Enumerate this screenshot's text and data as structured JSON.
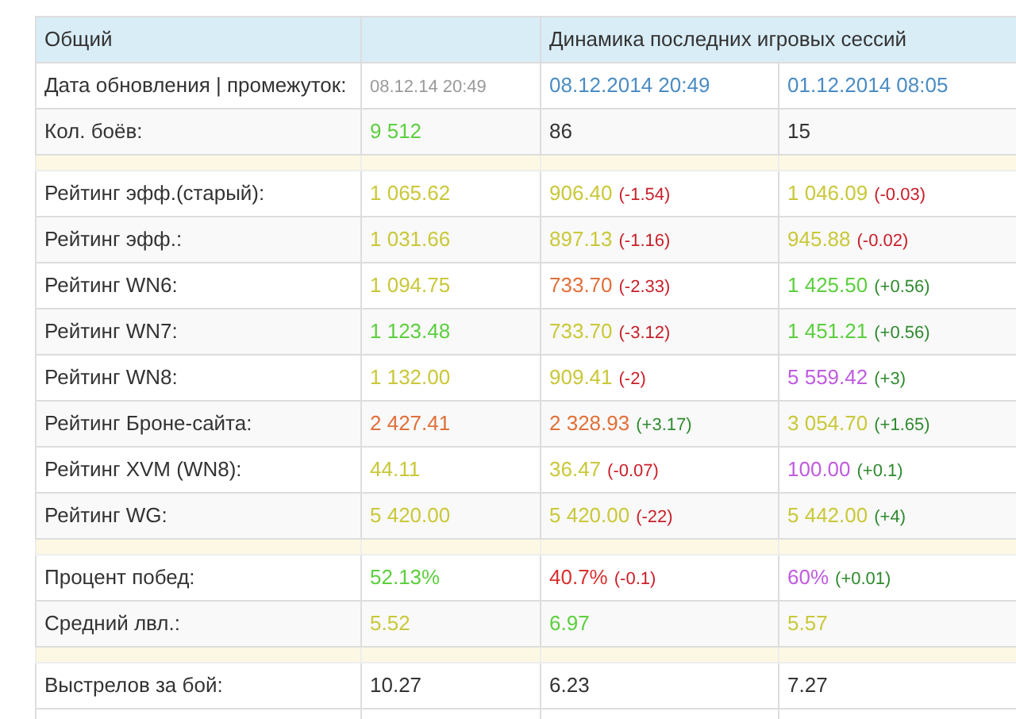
{
  "header": {
    "section": "Общий",
    "dynamics": "Динамика последних игровых сессий"
  },
  "rows": [
    {
      "kind": "data",
      "label": "Дата обновления | промежуток:",
      "cells": [
        {
          "value": "08.12.14 20:49",
          "color": "#9a9a9a",
          "small": true
        },
        {
          "value": "08.12.2014 20:49",
          "color": "#4a8cc4"
        },
        {
          "value": "01.12.2014 08:05",
          "color": "#4a8cc4"
        }
      ]
    },
    {
      "kind": "data",
      "label": "Кол. боёв:",
      "cells": [
        {
          "value": "9 512",
          "color": "#5ccf3e"
        },
        {
          "value": "86",
          "color": "#333333"
        },
        {
          "value": "15",
          "color": "#333333"
        }
      ]
    },
    {
      "kind": "separator"
    },
    {
      "kind": "data",
      "label": "Рейтинг эфф.(старый):",
      "cells": [
        {
          "value": "1 065.62",
          "color": "#c9c83a"
        },
        {
          "value": "906.40",
          "color": "#c9c83a",
          "delta": {
            "text": "(-1.54)",
            "color": "#c8202a"
          }
        },
        {
          "value": "1 046.09",
          "color": "#c9c83a",
          "delta": {
            "text": "(-0.03)",
            "color": "#c8202a"
          }
        }
      ]
    },
    {
      "kind": "data",
      "label": "Рейтинг эфф.:",
      "cells": [
        {
          "value": "1 031.66",
          "color": "#c9c83a"
        },
        {
          "value": "897.13",
          "color": "#c9c83a",
          "delta": {
            "text": "(-1.16)",
            "color": "#c8202a"
          }
        },
        {
          "value": "945.88",
          "color": "#c9c83a",
          "delta": {
            "text": "(-0.02)",
            "color": "#c8202a"
          }
        }
      ]
    },
    {
      "kind": "data",
      "label": "Рейтинг WN6:",
      "cells": [
        {
          "value": "1 094.75",
          "color": "#c9c83a"
        },
        {
          "value": "733.70",
          "color": "#e0703a",
          "delta": {
            "text": "(-2.33)",
            "color": "#c8202a"
          }
        },
        {
          "value": "1 425.50",
          "color": "#5ccf3e",
          "delta": {
            "text": "(+0.56)",
            "color": "#2f8a2f"
          }
        }
      ]
    },
    {
      "kind": "data",
      "label": "Рейтинг WN7:",
      "cells": [
        {
          "value": "1 123.48",
          "color": "#5ccf3e"
        },
        {
          "value": "733.70",
          "color": "#c9c83a",
          "delta": {
            "text": "(-3.12)",
            "color": "#c8202a"
          }
        },
        {
          "value": "1 451.21",
          "color": "#5ccf3e",
          "delta": {
            "text": "(+0.56)",
            "color": "#2f8a2f"
          }
        }
      ]
    },
    {
      "kind": "data",
      "label": "Рейтинг WN8:",
      "cells": [
        {
          "value": "1 132.00",
          "color": "#c9c83a"
        },
        {
          "value": "909.41",
          "color": "#c9c83a",
          "delta": {
            "text": "(-2)",
            "color": "#c8202a"
          }
        },
        {
          "value": "5 559.42",
          "color": "#c05ce0",
          "delta": {
            "text": "(+3)",
            "color": "#2f8a2f"
          }
        }
      ]
    },
    {
      "kind": "data",
      "label": "Рейтинг Броне-сайта:",
      "cells": [
        {
          "value": "2 427.41",
          "color": "#e0703a"
        },
        {
          "value": "2 328.93",
          "color": "#e0703a",
          "delta": {
            "text": "(+3.17)",
            "color": "#2f8a2f"
          }
        },
        {
          "value": "3 054.70",
          "color": "#c9c83a",
          "delta": {
            "text": "(+1.65)",
            "color": "#2f8a2f"
          }
        }
      ]
    },
    {
      "kind": "data",
      "label": "Рейтинг XVM (WN8):",
      "cells": [
        {
          "value": "44.11",
          "color": "#c9c83a"
        },
        {
          "value": "36.47",
          "color": "#c9c83a",
          "delta": {
            "text": "(-0.07)",
            "color": "#c8202a"
          }
        },
        {
          "value": "100.00",
          "color": "#c05ce0",
          "delta": {
            "text": "(+0.1)",
            "color": "#2f8a2f"
          }
        }
      ]
    },
    {
      "kind": "data",
      "label": "Рейтинг WG:",
      "cells": [
        {
          "value": "5 420.00",
          "color": "#c9c83a"
        },
        {
          "value": "5 420.00",
          "color": "#c9c83a",
          "delta": {
            "text": "(-22)",
            "color": "#c8202a"
          }
        },
        {
          "value": "5 442.00",
          "color": "#c9c83a",
          "delta": {
            "text": "(+4)",
            "color": "#2f8a2f"
          }
        }
      ]
    },
    {
      "kind": "separator"
    },
    {
      "kind": "data",
      "label": "Процент побед:",
      "cells": [
        {
          "value": "52.13%",
          "color": "#5ccf3e"
        },
        {
          "value": "40.7%",
          "color": "#d9302f",
          "delta": {
            "text": "(-0.1)",
            "color": "#c8202a"
          }
        },
        {
          "value": "60%",
          "color": "#c05ce0",
          "delta": {
            "text": "(+0.01)",
            "color": "#2f8a2f"
          }
        }
      ]
    },
    {
      "kind": "data",
      "label": "Средний лвл.:",
      "cells": [
        {
          "value": "5.52",
          "color": "#c9c83a"
        },
        {
          "value": "6.97",
          "color": "#5ccf3e"
        },
        {
          "value": "5.57",
          "color": "#c9c83a"
        }
      ]
    },
    {
      "kind": "separator"
    },
    {
      "kind": "data",
      "label": "Выстрелов за бой:",
      "cells": [
        {
          "value": "10.27",
          "color": "#333333"
        },
        {
          "value": "6.23",
          "color": "#333333"
        },
        {
          "value": "7.27",
          "color": "#333333"
        }
      ]
    },
    {
      "kind": "blank"
    }
  ]
}
